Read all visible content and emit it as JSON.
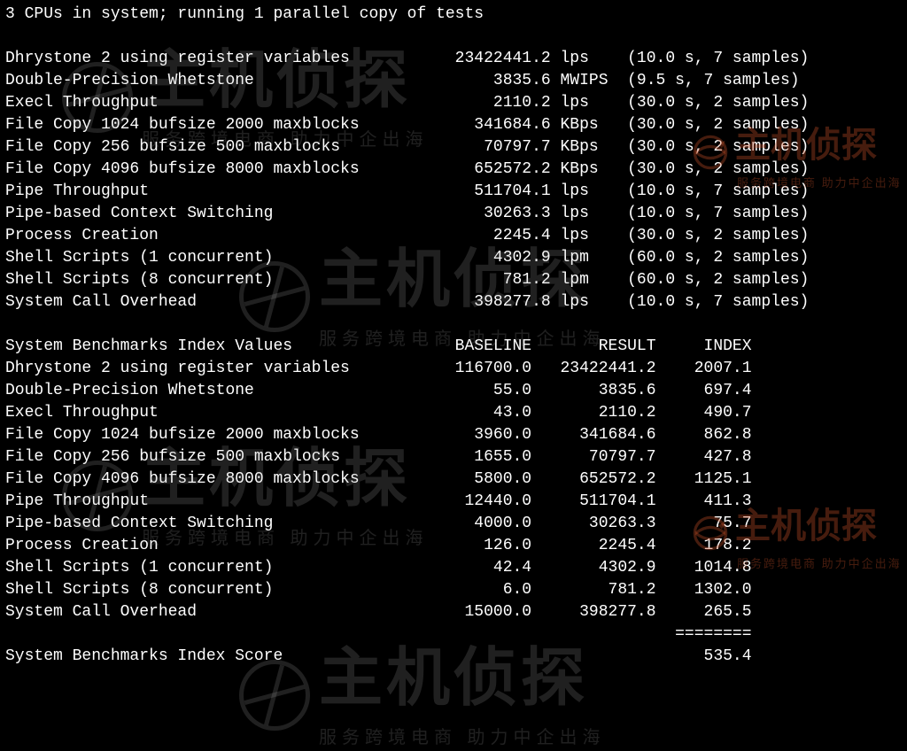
{
  "header": "3 CPUs in system; running 1 parallel copy of tests",
  "tests": [
    {
      "name": "Dhrystone 2 using register variables",
      "value": "23422441.2",
      "unit": "lps",
      "timing": "(10.0 s, 7 samples)"
    },
    {
      "name": "Double-Precision Whetstone",
      "value": "3835.6",
      "unit": "MWIPS",
      "timing": "(9.5 s, 7 samples)"
    },
    {
      "name": "Execl Throughput",
      "value": "2110.2",
      "unit": "lps",
      "timing": "(30.0 s, 2 samples)"
    },
    {
      "name": "File Copy 1024 bufsize 2000 maxblocks",
      "value": "341684.6",
      "unit": "KBps",
      "timing": "(30.0 s, 2 samples)"
    },
    {
      "name": "File Copy 256 bufsize 500 maxblocks",
      "value": "70797.7",
      "unit": "KBps",
      "timing": "(30.0 s, 2 samples)"
    },
    {
      "name": "File Copy 4096 bufsize 8000 maxblocks",
      "value": "652572.2",
      "unit": "KBps",
      "timing": "(30.0 s, 2 samples)"
    },
    {
      "name": "Pipe Throughput",
      "value": "511704.1",
      "unit": "lps",
      "timing": "(10.0 s, 7 samples)"
    },
    {
      "name": "Pipe-based Context Switching",
      "value": "30263.3",
      "unit": "lps",
      "timing": "(10.0 s, 7 samples)"
    },
    {
      "name": "Process Creation",
      "value": "2245.4",
      "unit": "lps",
      "timing": "(30.0 s, 2 samples)"
    },
    {
      "name": "Shell Scripts (1 concurrent)",
      "value": "4302.9",
      "unit": "lpm",
      "timing": "(60.0 s, 2 samples)"
    },
    {
      "name": "Shell Scripts (8 concurrent)",
      "value": "781.2",
      "unit": "lpm",
      "timing": "(60.0 s, 2 samples)"
    },
    {
      "name": "System Call Overhead",
      "value": "398277.8",
      "unit": "lps",
      "timing": "(10.0 s, 7 samples)"
    }
  ],
  "index_header": {
    "title": "System Benchmarks Index Values",
    "c1": "BASELINE",
    "c2": "RESULT",
    "c3": "INDEX"
  },
  "index_rows": [
    {
      "name": "Dhrystone 2 using register variables",
      "baseline": "116700.0",
      "result": "23422441.2",
      "index": "2007.1"
    },
    {
      "name": "Double-Precision Whetstone",
      "baseline": "55.0",
      "result": "3835.6",
      "index": "697.4"
    },
    {
      "name": "Execl Throughput",
      "baseline": "43.0",
      "result": "2110.2",
      "index": "490.7"
    },
    {
      "name": "File Copy 1024 bufsize 2000 maxblocks",
      "baseline": "3960.0",
      "result": "341684.6",
      "index": "862.8"
    },
    {
      "name": "File Copy 256 bufsize 500 maxblocks",
      "baseline": "1655.0",
      "result": "70797.7",
      "index": "427.8"
    },
    {
      "name": "File Copy 4096 bufsize 8000 maxblocks",
      "baseline": "5800.0",
      "result": "652572.2",
      "index": "1125.1"
    },
    {
      "name": "Pipe Throughput",
      "baseline": "12440.0",
      "result": "511704.1",
      "index": "411.3"
    },
    {
      "name": "Pipe-based Context Switching",
      "baseline": "4000.0",
      "result": "30263.3",
      "index": "75.7"
    },
    {
      "name": "Process Creation",
      "baseline": "126.0",
      "result": "2245.4",
      "index": "178.2"
    },
    {
      "name": "Shell Scripts (1 concurrent)",
      "baseline": "42.4",
      "result": "4302.9",
      "index": "1014.8"
    },
    {
      "name": "Shell Scripts (8 concurrent)",
      "baseline": "6.0",
      "result": "781.2",
      "index": "1302.0"
    },
    {
      "name": "System Call Overhead",
      "baseline": "15000.0",
      "result": "398277.8",
      "index": "265.5"
    }
  ],
  "separator": "========",
  "score_row": {
    "name": "System Benchmarks Index Score",
    "value": "535.4"
  },
  "watermark": {
    "main": "主机侦探",
    "sub": "服务跨境电商 助力中企出海"
  }
}
